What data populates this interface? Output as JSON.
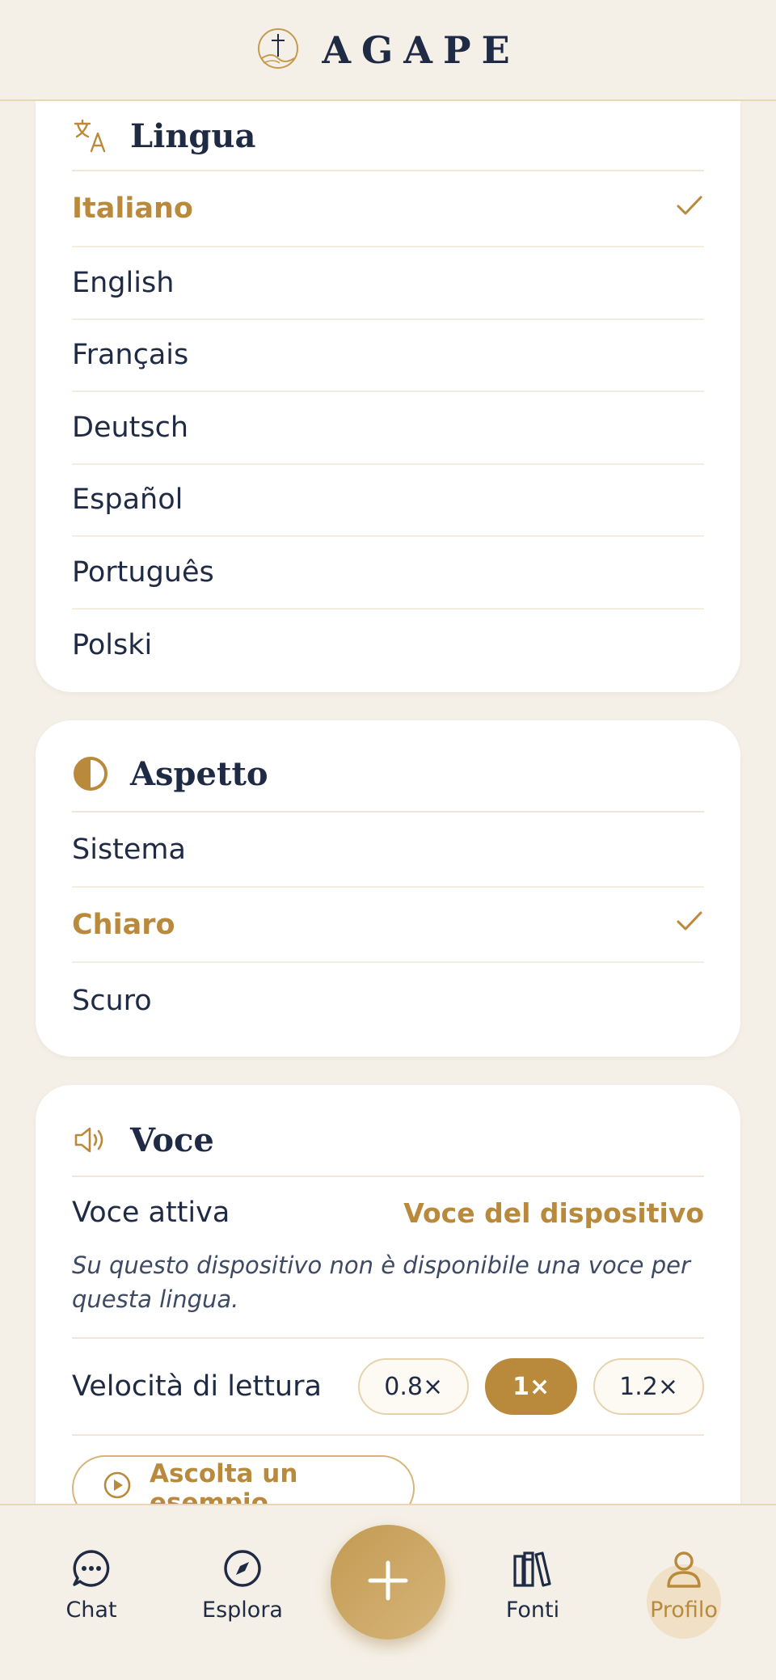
{
  "app": {
    "title": "AGAPE"
  },
  "language": {
    "title": "Lingua",
    "options": [
      {
        "label": "Italiano",
        "selected": true
      },
      {
        "label": "English",
        "selected": false
      },
      {
        "label": "Français",
        "selected": false
      },
      {
        "label": "Deutsch",
        "selected": false
      },
      {
        "label": "Español",
        "selected": false
      },
      {
        "label": "Português",
        "selected": false
      },
      {
        "label": "Polski",
        "selected": false
      }
    ]
  },
  "appearance": {
    "title": "Aspetto",
    "options": [
      {
        "label": "Sistema",
        "selected": false
      },
      {
        "label": "Chiaro",
        "selected": true
      },
      {
        "label": "Scuro",
        "selected": false
      }
    ]
  },
  "voice": {
    "title": "Voce",
    "active_label": "Voce attiva",
    "active_value": "Voce del dispositivo",
    "note": "Su questo dispositivo non è disponibile una voce per questa lingua.",
    "speed_label": "Velocità di lettura",
    "speeds": [
      {
        "label": "0.8×",
        "active": false
      },
      {
        "label": "1×",
        "active": true
      },
      {
        "label": "1.2×",
        "active": false
      }
    ],
    "listen_label": "Ascolta un esempio"
  },
  "nav": {
    "items": [
      {
        "label": "Chat",
        "icon": "chat-icon",
        "active": false
      },
      {
        "label": "Esplora",
        "icon": "compass-icon",
        "active": false
      },
      {
        "label": "Fonti",
        "icon": "books-icon",
        "active": false
      },
      {
        "label": "Profilo",
        "icon": "user-icon",
        "active": true
      }
    ],
    "fab_icon": "plus-icon"
  },
  "colors": {
    "accent": "#b98a3c",
    "text": "#1f2a44",
    "background": "#f4efe7",
    "card": "#ffffff"
  }
}
